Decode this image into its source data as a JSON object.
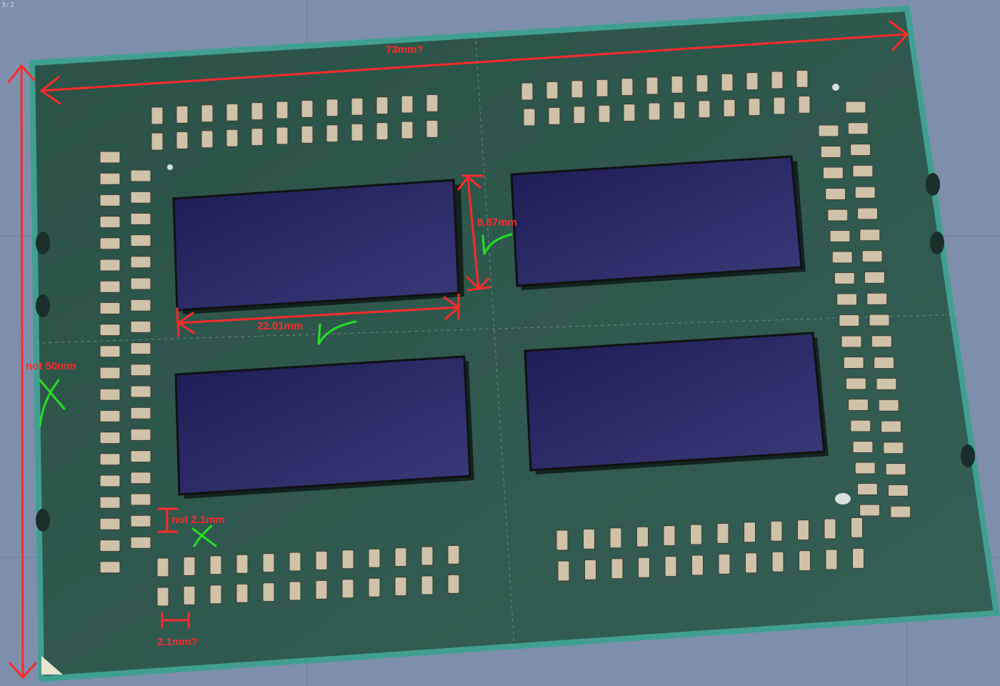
{
  "viewport": {
    "corner_label": "3:2"
  },
  "annotations": {
    "width_label": "73mm?",
    "height_label": "not 50mm",
    "die_height_label": "8.87mm",
    "die_width_label": "22.01mm",
    "pitch_label": "2.1mm?",
    "not_pitch_label": "not 2.1mm",
    "check_mark": "✓",
    "cross_mark": "✗"
  },
  "colors": {
    "background": "#7d8fab",
    "pcb": "#2f5a4f",
    "pcb_edge": "#3fa091",
    "die": "#242660",
    "capacitor": "#cfc2a8",
    "annotation_red": "#ff2a2a",
    "annotation_green": "#22e022"
  }
}
